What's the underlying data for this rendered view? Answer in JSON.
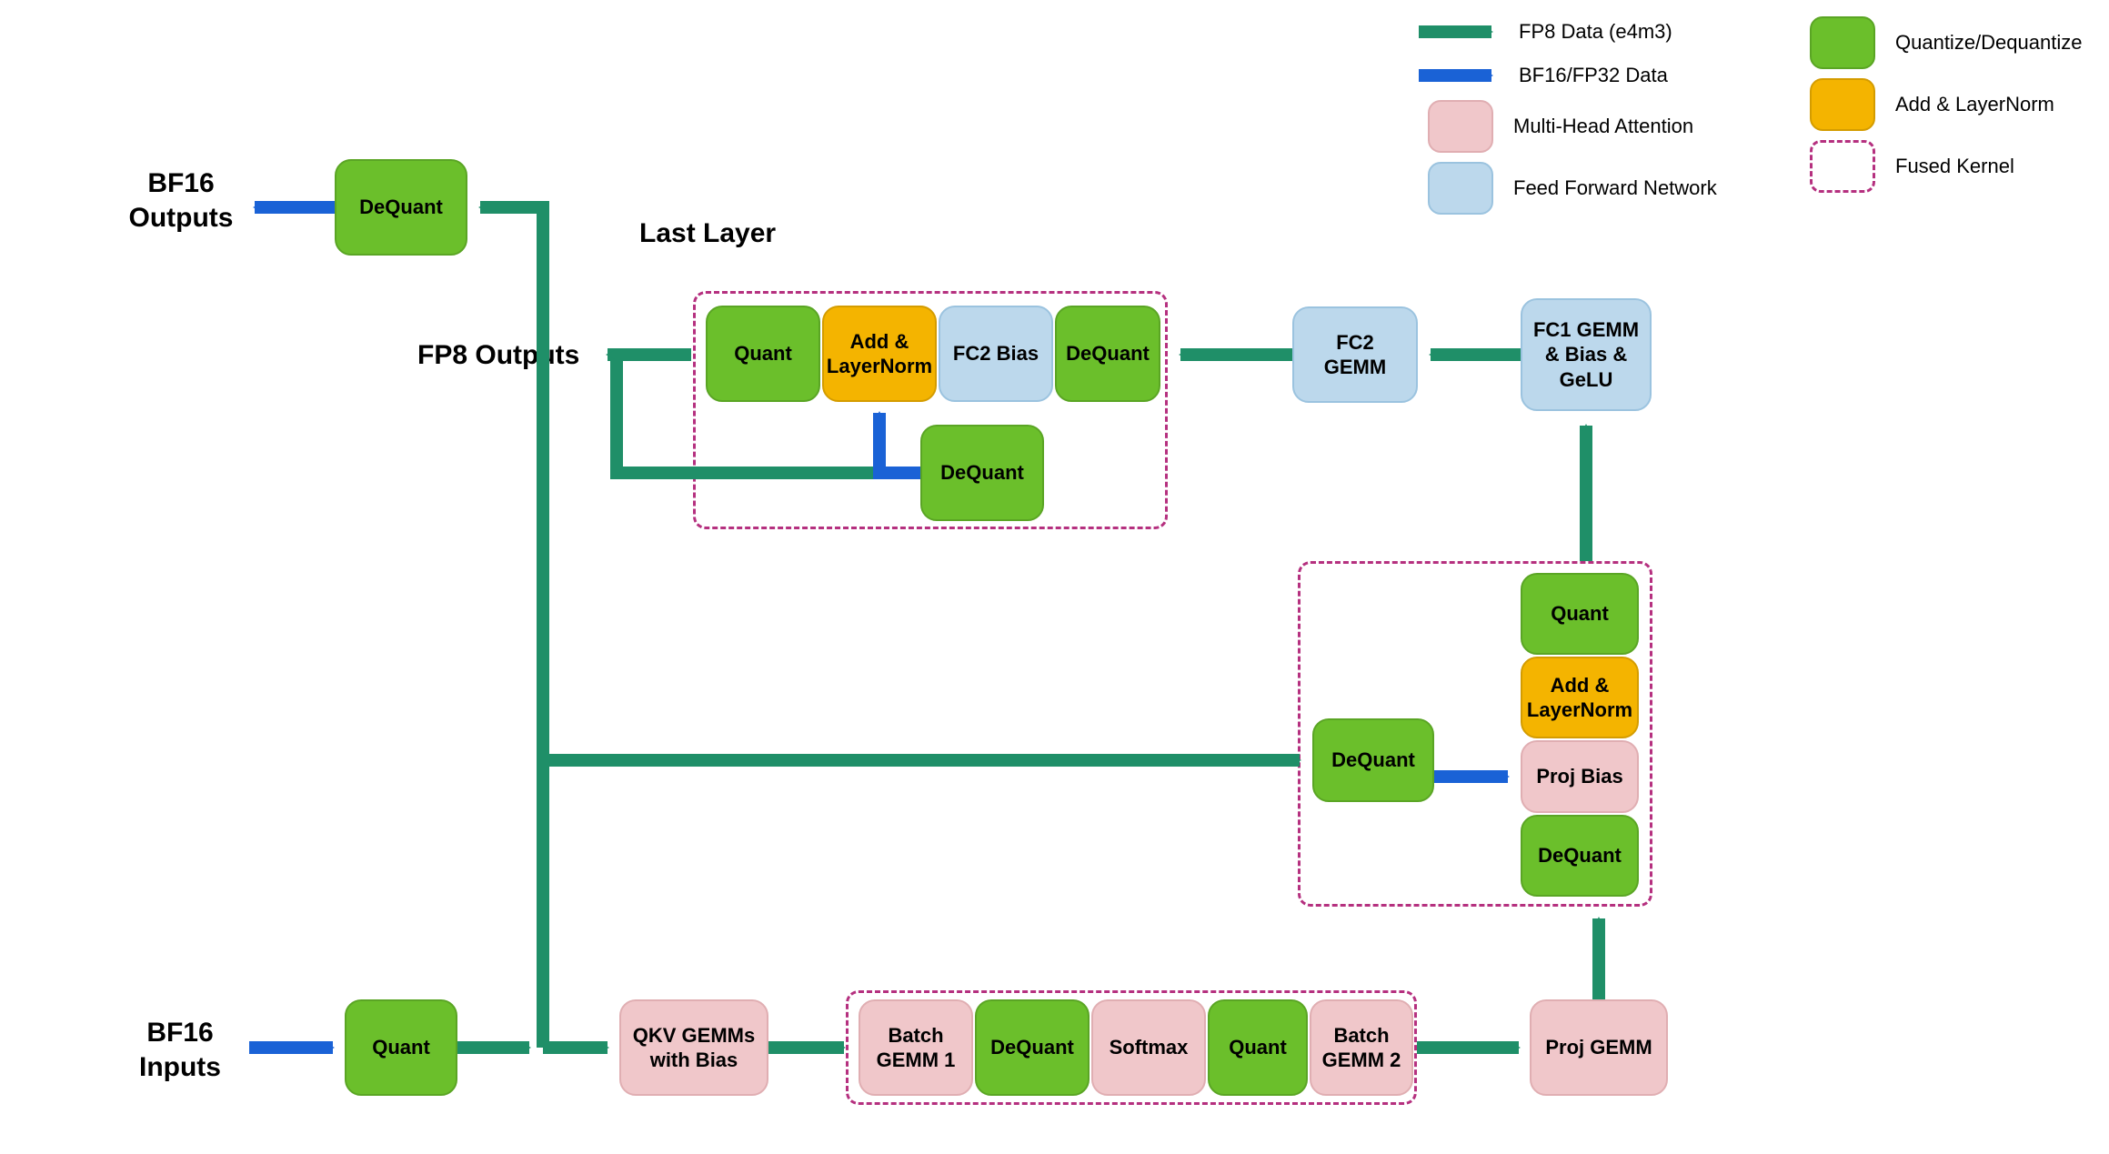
{
  "labels": {
    "bf16_outputs": "BF16\nOutputs",
    "bf16_inputs": "BF16\nInputs",
    "fp8_outputs": "FP8 Outputs",
    "last_layer": "Last Layer"
  },
  "nodes": {
    "dequant_top": "DeQuant",
    "quant_ffn": "Quant",
    "add_ln_ffn": "Add & LayerNorm",
    "fc2_bias": "FC2 Bias",
    "dequant_ffn_right": "DeQuant",
    "dequant_ffn_mid": "DeQuant",
    "fc2_gemm": "FC2 GEMM",
    "fc1_gemm": "FC1 GEMM & Bias & GeLU",
    "quant_attn_post": "Quant",
    "add_ln_attn": "Add & LayerNorm",
    "dequant_attn_left": "DeQuant",
    "proj_bias": "Proj Bias",
    "dequant_attn_bottom": "DeQuant",
    "quant_input": "Quant",
    "qkv": "QKV GEMMs with Bias",
    "bgemm1": "Batch GEMM 1",
    "dequant_softmax": "DeQuant",
    "softmax": "Softmax",
    "quant_softmax": "Quant",
    "bgemm2": "Batch GEMM 2",
    "proj_gemm": "Proj GEMM"
  },
  "legend": {
    "fp8_arrow": "FP8 Data (e4m3)",
    "bf16_arrow": "BF16/FP32 Data",
    "mha": "Multi-Head Attention",
    "ffn": "Feed Forward Network",
    "quant": "Quantize/Dequantize",
    "addln": "Add & LayerNorm",
    "fused": "Fused Kernel"
  },
  "colors": {
    "green": "#6bbf2b",
    "orange": "#f4b400",
    "blue_light": "#bcd8ec",
    "pink": "#f0c7ca",
    "arrow_green": "#1f8f68",
    "arrow_blue": "#1a62d6",
    "dashed": "#b5307f"
  }
}
